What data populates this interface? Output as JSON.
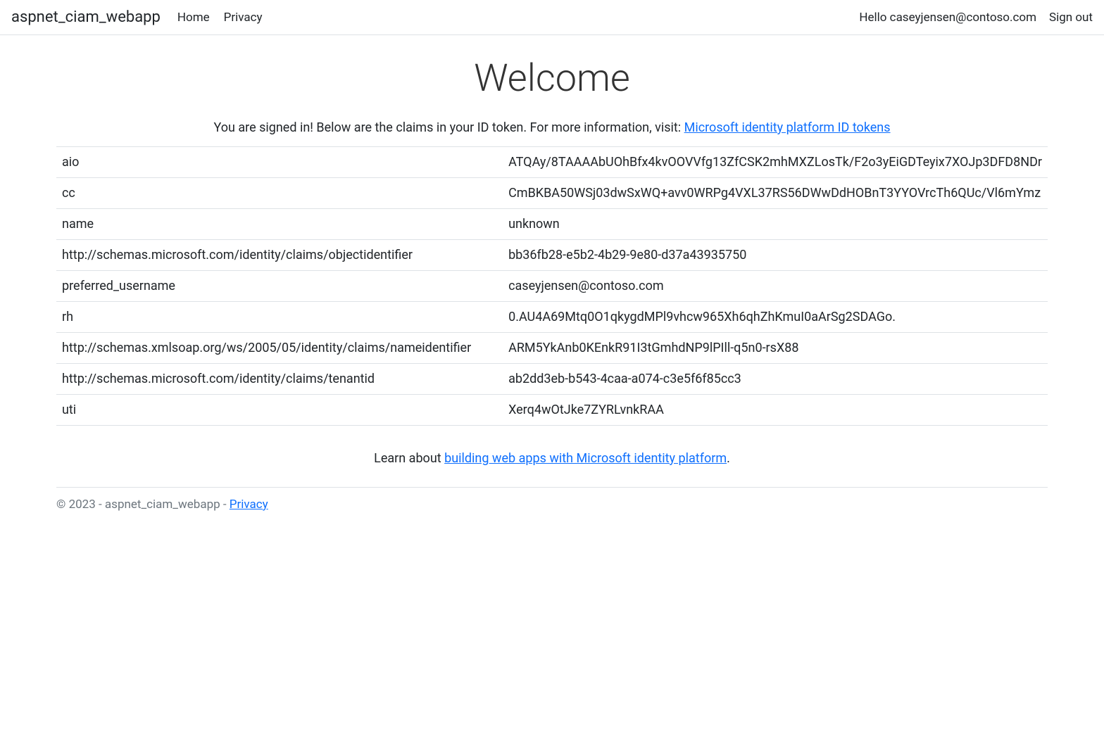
{
  "nav": {
    "brand": "aspnet_ciam_webapp",
    "home": "Home",
    "privacy": "Privacy",
    "greeting": "Hello caseyjensen@contoso.com",
    "signout": "Sign out"
  },
  "main": {
    "title": "Welcome",
    "intro_text": "You are signed in! Below are the claims in your ID token. For more information, visit: ",
    "intro_link": "Microsoft identity platform ID tokens",
    "learn_prefix": "Learn about ",
    "learn_link": "building web apps with Microsoft identity platform",
    "learn_suffix": "."
  },
  "claims": [
    {
      "key": "aio",
      "value": "ATQAy/8TAAAAbUOhBfx4kvOOVVfg13ZfCSK2mhMXZLosTk/F2o3yEiGDTeyix7XOJp3DFD8NDr"
    },
    {
      "key": "cc",
      "value": "CmBKBA50WSj03dwSxWQ+avv0WRPg4VXL37RS56DWwDdHOBnT3YYOVrcTh6QUc/Vl6mYmz"
    },
    {
      "key": "name",
      "value": "unknown"
    },
    {
      "key": "http://schemas.microsoft.com/identity/claims/objectidentifier",
      "value": "bb36fb28-e5b2-4b29-9e80-d37a43935750"
    },
    {
      "key": "preferred_username",
      "value": "caseyjensen@contoso.com"
    },
    {
      "key": "rh",
      "value": "0.AU4A69Mtq0O1qkygdMPl9vhcw965Xh6qhZhKmuI0aArSg2SDAGo."
    },
    {
      "key": "http://schemas.xmlsoap.org/ws/2005/05/identity/claims/nameidentifier",
      "value": "ARM5YkAnb0KEnkR91I3tGmhdNP9lPIll-q5n0-rsX88"
    },
    {
      "key": "http://schemas.microsoft.com/identity/claims/tenantid",
      "value": "ab2dd3eb-b543-4caa-a074-c3e5f6f85cc3"
    },
    {
      "key": "uti",
      "value": "Xerq4wOtJke7ZYRLvnkRAA"
    }
  ],
  "footer": {
    "text": "© 2023 - aspnet_ciam_webapp - ",
    "privacy": "Privacy"
  }
}
